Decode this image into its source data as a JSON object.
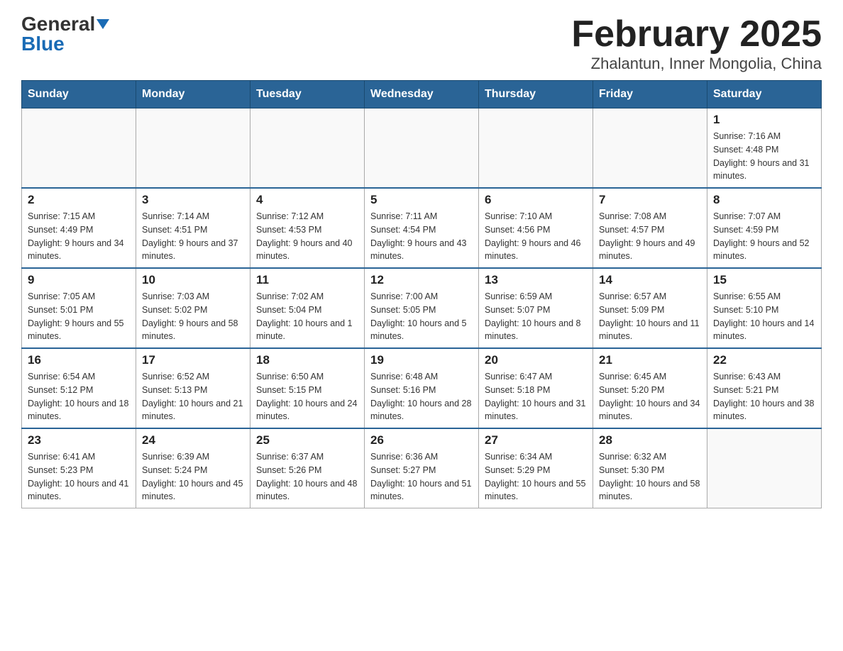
{
  "header": {
    "logo_general": "General",
    "logo_blue": "Blue",
    "title": "February 2025",
    "subtitle": "Zhalantun, Inner Mongolia, China"
  },
  "days_of_week": [
    "Sunday",
    "Monday",
    "Tuesday",
    "Wednesday",
    "Thursday",
    "Friday",
    "Saturday"
  ],
  "weeks": [
    [
      {
        "day": "",
        "info": ""
      },
      {
        "day": "",
        "info": ""
      },
      {
        "day": "",
        "info": ""
      },
      {
        "day": "",
        "info": ""
      },
      {
        "day": "",
        "info": ""
      },
      {
        "day": "",
        "info": ""
      },
      {
        "day": "1",
        "info": "Sunrise: 7:16 AM\nSunset: 4:48 PM\nDaylight: 9 hours and 31 minutes."
      }
    ],
    [
      {
        "day": "2",
        "info": "Sunrise: 7:15 AM\nSunset: 4:49 PM\nDaylight: 9 hours and 34 minutes."
      },
      {
        "day": "3",
        "info": "Sunrise: 7:14 AM\nSunset: 4:51 PM\nDaylight: 9 hours and 37 minutes."
      },
      {
        "day": "4",
        "info": "Sunrise: 7:12 AM\nSunset: 4:53 PM\nDaylight: 9 hours and 40 minutes."
      },
      {
        "day": "5",
        "info": "Sunrise: 7:11 AM\nSunset: 4:54 PM\nDaylight: 9 hours and 43 minutes."
      },
      {
        "day": "6",
        "info": "Sunrise: 7:10 AM\nSunset: 4:56 PM\nDaylight: 9 hours and 46 minutes."
      },
      {
        "day": "7",
        "info": "Sunrise: 7:08 AM\nSunset: 4:57 PM\nDaylight: 9 hours and 49 minutes."
      },
      {
        "day": "8",
        "info": "Sunrise: 7:07 AM\nSunset: 4:59 PM\nDaylight: 9 hours and 52 minutes."
      }
    ],
    [
      {
        "day": "9",
        "info": "Sunrise: 7:05 AM\nSunset: 5:01 PM\nDaylight: 9 hours and 55 minutes."
      },
      {
        "day": "10",
        "info": "Sunrise: 7:03 AM\nSunset: 5:02 PM\nDaylight: 9 hours and 58 minutes."
      },
      {
        "day": "11",
        "info": "Sunrise: 7:02 AM\nSunset: 5:04 PM\nDaylight: 10 hours and 1 minute."
      },
      {
        "day": "12",
        "info": "Sunrise: 7:00 AM\nSunset: 5:05 PM\nDaylight: 10 hours and 5 minutes."
      },
      {
        "day": "13",
        "info": "Sunrise: 6:59 AM\nSunset: 5:07 PM\nDaylight: 10 hours and 8 minutes."
      },
      {
        "day": "14",
        "info": "Sunrise: 6:57 AM\nSunset: 5:09 PM\nDaylight: 10 hours and 11 minutes."
      },
      {
        "day": "15",
        "info": "Sunrise: 6:55 AM\nSunset: 5:10 PM\nDaylight: 10 hours and 14 minutes."
      }
    ],
    [
      {
        "day": "16",
        "info": "Sunrise: 6:54 AM\nSunset: 5:12 PM\nDaylight: 10 hours and 18 minutes."
      },
      {
        "day": "17",
        "info": "Sunrise: 6:52 AM\nSunset: 5:13 PM\nDaylight: 10 hours and 21 minutes."
      },
      {
        "day": "18",
        "info": "Sunrise: 6:50 AM\nSunset: 5:15 PM\nDaylight: 10 hours and 24 minutes."
      },
      {
        "day": "19",
        "info": "Sunrise: 6:48 AM\nSunset: 5:16 PM\nDaylight: 10 hours and 28 minutes."
      },
      {
        "day": "20",
        "info": "Sunrise: 6:47 AM\nSunset: 5:18 PM\nDaylight: 10 hours and 31 minutes."
      },
      {
        "day": "21",
        "info": "Sunrise: 6:45 AM\nSunset: 5:20 PM\nDaylight: 10 hours and 34 minutes."
      },
      {
        "day": "22",
        "info": "Sunrise: 6:43 AM\nSunset: 5:21 PM\nDaylight: 10 hours and 38 minutes."
      }
    ],
    [
      {
        "day": "23",
        "info": "Sunrise: 6:41 AM\nSunset: 5:23 PM\nDaylight: 10 hours and 41 minutes."
      },
      {
        "day": "24",
        "info": "Sunrise: 6:39 AM\nSunset: 5:24 PM\nDaylight: 10 hours and 45 minutes."
      },
      {
        "day": "25",
        "info": "Sunrise: 6:37 AM\nSunset: 5:26 PM\nDaylight: 10 hours and 48 minutes."
      },
      {
        "day": "26",
        "info": "Sunrise: 6:36 AM\nSunset: 5:27 PM\nDaylight: 10 hours and 51 minutes."
      },
      {
        "day": "27",
        "info": "Sunrise: 6:34 AM\nSunset: 5:29 PM\nDaylight: 10 hours and 55 minutes."
      },
      {
        "day": "28",
        "info": "Sunrise: 6:32 AM\nSunset: 5:30 PM\nDaylight: 10 hours and 58 minutes."
      },
      {
        "day": "",
        "info": ""
      }
    ]
  ]
}
